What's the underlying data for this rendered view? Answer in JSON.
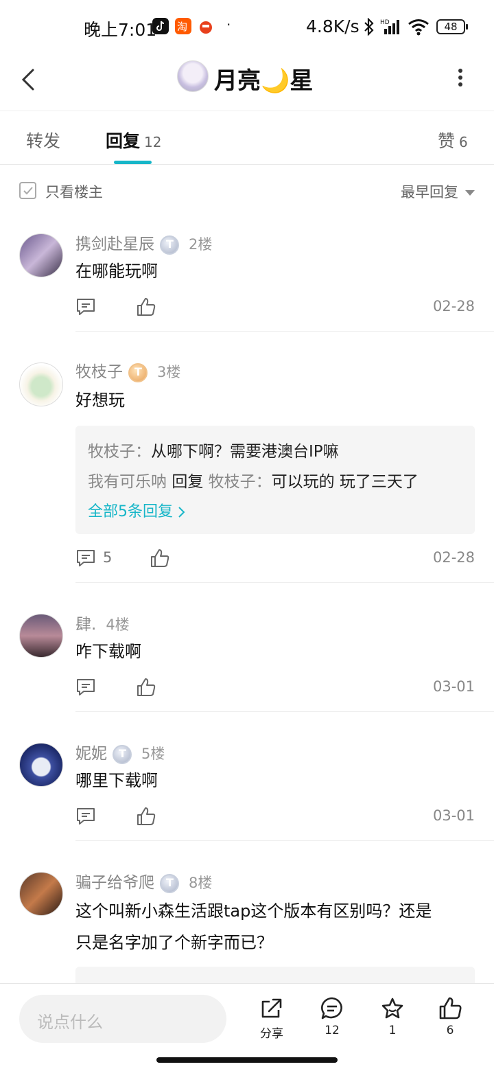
{
  "status_bar": {
    "time": "晚上7:01",
    "net_speed": "4.8K/s",
    "battery": "48",
    "dot": "·"
  },
  "header": {
    "title": "月亮🌙星"
  },
  "tabs": [
    {
      "label": "转发",
      "count": ""
    },
    {
      "label": "回复",
      "count": "12"
    },
    {
      "label": "赞",
      "count": "6"
    }
  ],
  "filter": {
    "only_op_label": "只看楼主",
    "sort_label": "最早回复"
  },
  "comments": [
    {
      "name": "携剑赴星辰",
      "badge": "silver",
      "floor": "2楼",
      "text": "在哪能玩啊",
      "reply_count": "",
      "date": "02-28"
    },
    {
      "name": "牧枝子",
      "badge": "gold",
      "floor": "3楼",
      "text": "好想玩",
      "reply_count": "5",
      "date": "02-28",
      "replies": [
        {
          "author": "牧枝子",
          "sep": "：",
          "text": "从哪下啊？需要港澳台IP嘛"
        },
        {
          "author": "我有可乐呐",
          "verb": "回复",
          "target": "牧枝子",
          "sep": "：",
          "text": "可以玩的  玩了三天了"
        }
      ],
      "all_replies": "全部5条回复"
    },
    {
      "name": "肆.",
      "badge": "",
      "floor": "4楼",
      "text": "咋下载啊",
      "reply_count": "",
      "date": "03-01"
    },
    {
      "name": "妮妮",
      "badge": "silver",
      "floor": "5楼",
      "text": "哪里下载啊",
      "reply_count": "",
      "date": "03-01"
    },
    {
      "name": "骗子给爷爬",
      "badge": "silver",
      "floor": "8楼",
      "text_line1": "这个叫新小森生活跟tap这个版本有区别吗？还是",
      "text_line2": "只是名字加了个新字而已？"
    }
  ],
  "bottom_bar": {
    "input_placeholder": "说点什么",
    "share_label": "分享",
    "comments_count": "12",
    "favorites_count": "1",
    "likes_count": "6"
  },
  "accent_color": "#17b6c8"
}
